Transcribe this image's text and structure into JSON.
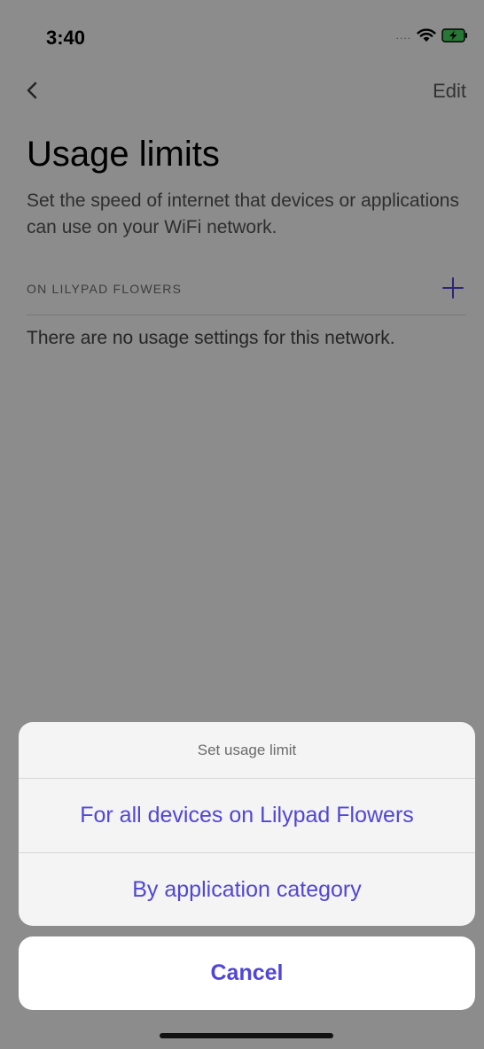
{
  "status_bar": {
    "time": "3:40",
    "signal": "....",
    "icons": [
      "wifi-icon",
      "battery-charging-icon"
    ]
  },
  "nav": {
    "back_icon": "chevron-left-icon",
    "edit_label": "Edit"
  },
  "page": {
    "title": "Usage limits",
    "subtitle": "Set the speed of internet that devices or applications can use on your WiFi network.",
    "section_label": "ON LILYPAD FLOWERS",
    "add_icon": "plus-icon",
    "empty_message": "There are no usage settings for this network."
  },
  "action_sheet": {
    "title": "Set usage limit",
    "options": [
      {
        "label": "For all devices on Lilypad Flowers"
      },
      {
        "label": "By application category"
      }
    ],
    "cancel_label": "Cancel"
  },
  "colors": {
    "accent": "#5046d8",
    "overlay": "rgba(0,0,0,0.45)"
  }
}
